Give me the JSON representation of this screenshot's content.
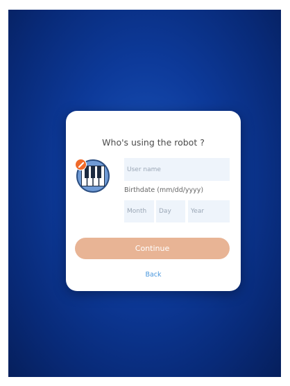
{
  "dialog": {
    "title": "Who's using the robot ?",
    "username_placeholder": "User name",
    "birthdate_label": "Birthdate (mm/dd/yyyy)",
    "month_placeholder": "Month",
    "day_placeholder": "Day",
    "year_placeholder": "Year",
    "continue_label": "Continue",
    "back_label": "Back"
  },
  "icons": {
    "avatar": "piano-keys-icon",
    "edit_badge": "pencil-icon"
  },
  "colors": {
    "background": "#0d3a9a",
    "continue_button": "#e8b495",
    "edit_badge": "#ef6a2b",
    "back_link": "#4a97dd"
  }
}
